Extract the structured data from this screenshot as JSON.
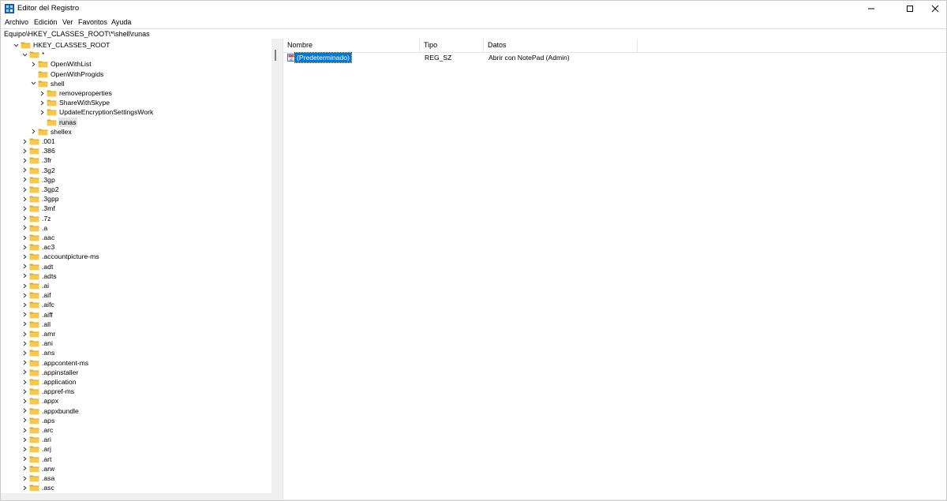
{
  "window": {
    "title": "Editor del Registro",
    "icon": "regedit-icon"
  },
  "menu": [
    "Archivo",
    "Edición",
    "Ver",
    "Favoritos",
    "Ayuda"
  ],
  "address": {
    "path": "Equipo\\HKEY_CLASSES_ROOT\\*\\shell\\runas"
  },
  "tree": [
    {
      "label": "HKEY_CLASSES_ROOT",
      "depth": 0,
      "state": "expanded"
    },
    {
      "label": "*",
      "depth": 1,
      "state": "expanded"
    },
    {
      "label": "OpenWithList",
      "depth": 2,
      "state": "collapsed"
    },
    {
      "label": "OpenWithProgids",
      "depth": 2,
      "state": "none"
    },
    {
      "label": "shell",
      "depth": 2,
      "state": "expanded"
    },
    {
      "label": "removeproperties",
      "depth": 3,
      "state": "collapsed"
    },
    {
      "label": "ShareWithSkype",
      "depth": 3,
      "state": "collapsed"
    },
    {
      "label": "UpdateEncryptionSettingsWork",
      "depth": 3,
      "state": "collapsed"
    },
    {
      "label": "runas",
      "depth": 3,
      "state": "none",
      "selected": true
    },
    {
      "label": "shellex",
      "depth": 2,
      "state": "collapsed"
    },
    {
      "label": ".001",
      "depth": 1,
      "state": "collapsed"
    },
    {
      "label": ".386",
      "depth": 1,
      "state": "collapsed"
    },
    {
      "label": ".3fr",
      "depth": 1,
      "state": "collapsed"
    },
    {
      "label": ".3g2",
      "depth": 1,
      "state": "collapsed"
    },
    {
      "label": ".3gp",
      "depth": 1,
      "state": "collapsed"
    },
    {
      "label": ".3gp2",
      "depth": 1,
      "state": "collapsed"
    },
    {
      "label": ".3gpp",
      "depth": 1,
      "state": "collapsed"
    },
    {
      "label": ".3mf",
      "depth": 1,
      "state": "collapsed"
    },
    {
      "label": ".7z",
      "depth": 1,
      "state": "collapsed"
    },
    {
      "label": ".a",
      "depth": 1,
      "state": "collapsed"
    },
    {
      "label": ".aac",
      "depth": 1,
      "state": "collapsed"
    },
    {
      "label": ".ac3",
      "depth": 1,
      "state": "collapsed"
    },
    {
      "label": ".accountpicture-ms",
      "depth": 1,
      "state": "collapsed"
    },
    {
      "label": ".adt",
      "depth": 1,
      "state": "collapsed"
    },
    {
      "label": ".adts",
      "depth": 1,
      "state": "collapsed"
    },
    {
      "label": ".ai",
      "depth": 1,
      "state": "collapsed"
    },
    {
      "label": ".aif",
      "depth": 1,
      "state": "collapsed"
    },
    {
      "label": ".aifc",
      "depth": 1,
      "state": "collapsed"
    },
    {
      "label": ".aiff",
      "depth": 1,
      "state": "collapsed"
    },
    {
      "label": ".all",
      "depth": 1,
      "state": "collapsed"
    },
    {
      "label": ".amr",
      "depth": 1,
      "state": "collapsed"
    },
    {
      "label": ".ani",
      "depth": 1,
      "state": "collapsed"
    },
    {
      "label": ".ans",
      "depth": 1,
      "state": "collapsed"
    },
    {
      "label": ".appcontent-ms",
      "depth": 1,
      "state": "collapsed"
    },
    {
      "label": ".appinstaller",
      "depth": 1,
      "state": "collapsed"
    },
    {
      "label": ".application",
      "depth": 1,
      "state": "collapsed"
    },
    {
      "label": ".appref-ms",
      "depth": 1,
      "state": "collapsed"
    },
    {
      "label": ".appx",
      "depth": 1,
      "state": "collapsed"
    },
    {
      "label": ".appxbundle",
      "depth": 1,
      "state": "collapsed"
    },
    {
      "label": ".aps",
      "depth": 1,
      "state": "collapsed"
    },
    {
      "label": ".arc",
      "depth": 1,
      "state": "collapsed"
    },
    {
      "label": ".ari",
      "depth": 1,
      "state": "collapsed"
    },
    {
      "label": ".arj",
      "depth": 1,
      "state": "collapsed"
    },
    {
      "label": ".art",
      "depth": 1,
      "state": "collapsed"
    },
    {
      "label": ".arw",
      "depth": 1,
      "state": "collapsed"
    },
    {
      "label": ".asa",
      "depth": 1,
      "state": "collapsed"
    },
    {
      "label": ".asc",
      "depth": 1,
      "state": "collapsed"
    }
  ],
  "values": {
    "columns": [
      "Nombre",
      "Tipo",
      "Datos"
    ],
    "rows": [
      {
        "name": "(Predeterminado)",
        "type": "REG_SZ",
        "data": "Abrir con NotePad (Admin)",
        "icon": "reg-string-icon",
        "selected": true
      }
    ]
  },
  "colors": {
    "selection": "#0078d7",
    "folder": "#f6c94e",
    "folder_dark": "#e3a91f"
  }
}
